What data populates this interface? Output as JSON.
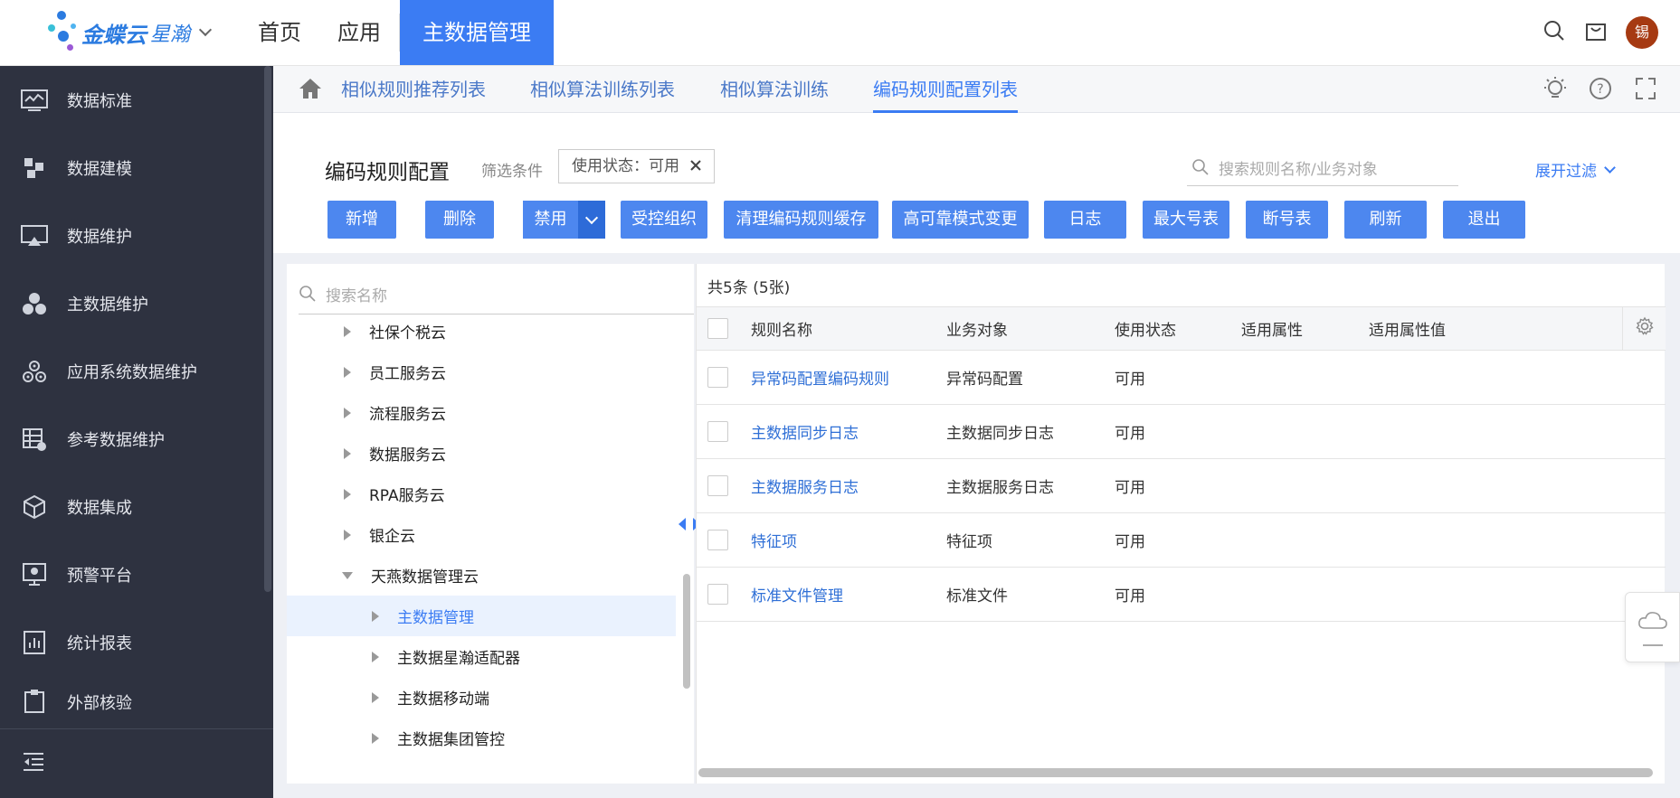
{
  "app": {
    "logo_text": "金蝶云",
    "logo_sub": "星瀚",
    "avatar_text": "锡",
    "colors": {
      "primary": "#3b7cf3",
      "sidebar_bg": "#2e3240",
      "avatar_bg": "#a63a12"
    }
  },
  "topnav": {
    "items": [
      "首页",
      "应用",
      "主数据管理"
    ],
    "active": "主数据管理"
  },
  "sidebar": {
    "items": [
      {
        "label": "数据标准",
        "icon": "chart-monitor-icon"
      },
      {
        "label": "数据建模",
        "icon": "cubes-icon"
      },
      {
        "label": "数据维护",
        "icon": "monitor-icon"
      },
      {
        "label": "主数据维护",
        "icon": "three-circles-icon"
      },
      {
        "label": "应用系统数据维护",
        "icon": "gear-cluster-icon"
      },
      {
        "label": "参考数据维护",
        "icon": "table-check-icon"
      },
      {
        "label": "数据集成",
        "icon": "box-icon"
      },
      {
        "label": "预警平台",
        "icon": "alert-screen-icon"
      },
      {
        "label": "统计报表",
        "icon": "bar-report-icon"
      },
      {
        "label": "外部核验",
        "icon": "clipboard-icon"
      }
    ]
  },
  "tabs": {
    "items": [
      "相似规则推荐列表",
      "相似算法训练列表",
      "相似算法训练",
      "编码规则配置列表"
    ],
    "active": "编码规则配置列表"
  },
  "page": {
    "title": "编码规则配置",
    "filter_label": "筛选条件",
    "filter_chip": "使用状态：可用",
    "search_placeholder": "搜索规则名称/业务对象",
    "expand_filter": "展开过滤"
  },
  "toolbar": {
    "buttons": [
      "新增",
      "删除",
      "禁用",
      "受控组织",
      "清理编码规则缓存",
      "高可靠模式变更",
      "日志",
      "最大号表",
      "断号表",
      "刷新",
      "退出"
    ]
  },
  "tree": {
    "search_placeholder": "搜索名称",
    "items": [
      {
        "label": "社保个税云",
        "level": 1,
        "expanded": false
      },
      {
        "label": "员工服务云",
        "level": 1,
        "expanded": false
      },
      {
        "label": "流程服务云",
        "level": 1,
        "expanded": false
      },
      {
        "label": "数据服务云",
        "level": 1,
        "expanded": false
      },
      {
        "label": "RPA服务云",
        "level": 1,
        "expanded": false
      },
      {
        "label": "银企云",
        "level": 1,
        "expanded": false
      },
      {
        "label": "天燕数据管理云",
        "level": 1,
        "expanded": true
      },
      {
        "label": "主数据管理",
        "level": 2,
        "expanded": false,
        "selected": true
      },
      {
        "label": "主数据星瀚适配器",
        "level": 2,
        "expanded": false
      },
      {
        "label": "主数据移动端",
        "level": 2,
        "expanded": false
      },
      {
        "label": "主数据集团管控",
        "level": 2,
        "expanded": false
      }
    ]
  },
  "grid": {
    "count_text": "共5条 (5张)",
    "columns": [
      "规则名称",
      "业务对象",
      "使用状态",
      "适用属性",
      "适用属性值"
    ],
    "rows": [
      [
        "异常码配置编码规则",
        "异常码配置",
        "可用",
        "",
        ""
      ],
      [
        "主数据同步日志",
        "主数据同步日志",
        "可用",
        "",
        ""
      ],
      [
        "主数据服务日志",
        "主数据服务日志",
        "可用",
        "",
        ""
      ],
      [
        "特征项",
        "特征项",
        "可用",
        "",
        ""
      ],
      [
        "标准文件管理",
        "标准文件",
        "可用",
        "",
        ""
      ]
    ]
  }
}
